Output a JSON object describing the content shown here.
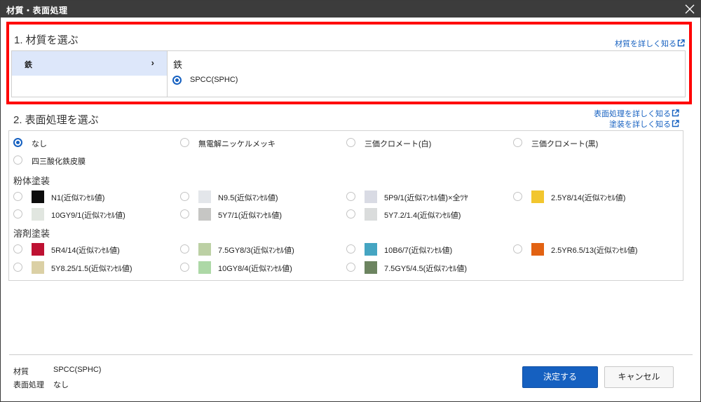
{
  "window": {
    "title": "材質・表面処理"
  },
  "section1": {
    "heading": "1. 材質を選ぶ",
    "detail_link": "材質を詳しく知る",
    "materials": [
      {
        "label": "鉄",
        "selected": true
      }
    ],
    "right_title": "鉄",
    "options": [
      {
        "label": "SPCC(SPHC)",
        "selected": true
      }
    ]
  },
  "section2": {
    "heading": "2. 表面処理を選ぶ",
    "links": {
      "surface": "表面処理を詳しく知る",
      "coating": "塗装を詳しく知る"
    },
    "basic_options": [
      {
        "label": "なし",
        "selected": true
      },
      {
        "label": "無電解ニッケルメッキ",
        "selected": false
      },
      {
        "label": "三価クロメート(白)",
        "selected": false
      },
      {
        "label": "三価クロメート(黒)",
        "selected": false
      },
      {
        "label": "四三酸化鉄皮膜",
        "selected": false
      }
    ],
    "powder": {
      "title": "粉体塗装",
      "options": [
        {
          "label": "N1(近似ﾏﾝｾﾙ値)",
          "color": "#0d0d0d"
        },
        {
          "label": "N9.5(近似ﾏﾝｾﾙ値)",
          "color": "#e3e6ea"
        },
        {
          "label": "5P9/1(近似ﾏﾝｾﾙ値)×全ﾂﾔ",
          "color": "#d9dbe4"
        },
        {
          "label": "2.5Y8/14(近似ﾏﾝｾﾙ値)",
          "color": "#f2c62e"
        },
        {
          "label": "10GY9/1(近似ﾏﾝｾﾙ値)",
          "color": "#e1e6e0"
        },
        {
          "label": "5Y7/1(近似ﾏﾝｾﾙ値)",
          "color": "#c6c6c4"
        },
        {
          "label": "5Y7.2/1.4(近似ﾏﾝｾﾙ値)",
          "color": "#dadcdc"
        }
      ]
    },
    "solvent": {
      "title": "溶剤塗装",
      "options": [
        {
          "label": "5R4/14(近似ﾏﾝｾﾙ値)",
          "color": "#be1132"
        },
        {
          "label": "7.5GY8/3(近似ﾏﾝｾﾙ値)",
          "color": "#bcd0a4"
        },
        {
          "label": "10B6/7(近似ﾏﾝｾﾙ値)",
          "color": "#45a5c2"
        },
        {
          "label": "2.5YR6.5/13(近似ﾏﾝｾﾙ値)",
          "color": "#e26212"
        },
        {
          "label": "5Y8.25/1.5(近似ﾏﾝｾﾙ値)",
          "color": "#dbd0a5"
        },
        {
          "label": "10GY8/4(近似ﾏﾝｾﾙ値)",
          "color": "#add8a6"
        },
        {
          "label": "7.5GY5/4.5(近似ﾏﾝｾﾙ値)",
          "color": "#6c8460"
        }
      ]
    }
  },
  "summary": {
    "material_label": "材質",
    "material_value": "SPCC(SPHC)",
    "surface_label": "表面処理",
    "surface_value": "なし"
  },
  "buttons": {
    "confirm": "決定する",
    "cancel": "キャンセル"
  },
  "colors": {
    "accent": "#1560c0",
    "highlight": "#ff0000",
    "selected_bg": "#dde7fa",
    "titlebar": "#3c3c3c"
  }
}
